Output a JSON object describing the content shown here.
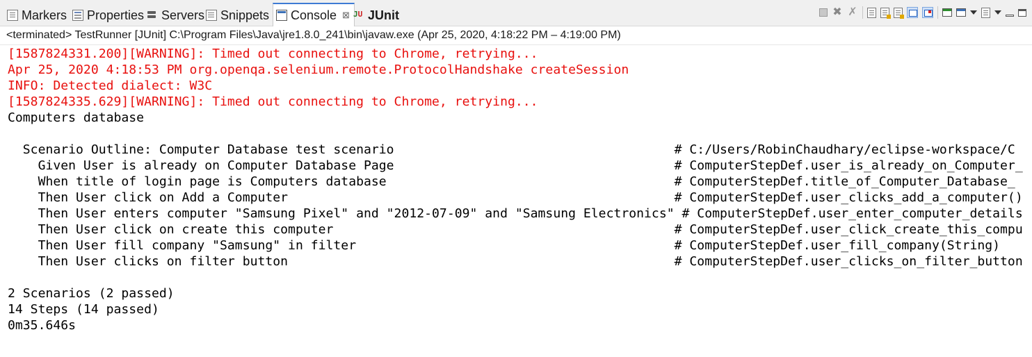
{
  "tabs": [
    {
      "label": "Markers",
      "icon": "markers-icon",
      "active": false
    },
    {
      "label": "Properties",
      "icon": "properties-icon",
      "active": false
    },
    {
      "label": "Servers",
      "icon": "servers-icon",
      "active": false
    },
    {
      "label": "Snippets",
      "icon": "snippets-icon",
      "active": false
    },
    {
      "label": "Console",
      "icon": "console-icon",
      "active": true,
      "close": "⊠"
    },
    {
      "label": "JUnit",
      "icon": "junit-icon",
      "active": false
    }
  ],
  "toolbar_icons": [
    "terminate-icon",
    "remove-launch-icon",
    "remove-all-terminated-icon",
    "scroll-lock-icon",
    "word-wrap-icon",
    "show-console-on-stdout-icon",
    "show-console-on-stderr-icon",
    "pin-console-icon",
    "display-selected-console-icon",
    "open-console-icon",
    "minimize-icon",
    "maximize-icon"
  ],
  "status_text": "<terminated> TestRunner [JUnit] C:\\Program Files\\Java\\jre1.8.0_241\\bin\\javaw.exe  (Apr 25, 2020, 4:18:22 PM – 4:19:00 PM)",
  "console_lines": [
    {
      "text": "[1587824331.200][WARNING]: Timed out connecting to Chrome, retrying...",
      "stream": "stderr"
    },
    {
      "text": "Apr 25, 2020 4:18:53 PM org.openqa.selenium.remote.ProtocolHandshake createSession",
      "stream": "stderr"
    },
    {
      "text": "INFO: Detected dialect: W3C",
      "stream": "stderr"
    },
    {
      "text": "[1587824335.629][WARNING]: Timed out connecting to Chrome, retrying...",
      "stream": "stderr"
    },
    {
      "text": "Computers database",
      "stream": "stdout"
    },
    {
      "text": "",
      "stream": "stdout"
    },
    {
      "text": "  Scenario Outline: Computer Database test scenario                                     # C:/Users/RobinChaudhary/eclipse-workspace/C",
      "stream": "stdout"
    },
    {
      "text": "    Given User is already on Computer Database Page                                     # ComputerStepDef.user_is_already_on_Computer_",
      "stream": "stdout"
    },
    {
      "text": "    When title of login page is Computers database                                      # ComputerStepDef.title_of_Computer_Database_",
      "stream": "stdout"
    },
    {
      "text": "    Then User click on Add a Computer                                                   # ComputerStepDef.user_clicks_add_a_computer()",
      "stream": "stdout"
    },
    {
      "text": "    Then User enters computer \"Samsung Pixel\" and \"2012-07-09\" and \"Samsung Electronics\" # ComputerStepDef.user_enter_computer_details",
      "stream": "stdout"
    },
    {
      "text": "    Then User click on create this computer                                             # ComputerStepDef.user_click_create_this_compu",
      "stream": "stdout"
    },
    {
      "text": "    Then User fill company \"Samsung\" in filter                                          # ComputerStepDef.user_fill_company(String)",
      "stream": "stdout"
    },
    {
      "text": "    Then User clicks on filter button                                                   # ComputerStepDef.user_clicks_on_filter_button",
      "stream": "stdout"
    },
    {
      "text": "",
      "stream": "stdout"
    },
    {
      "text": "2 Scenarios (2 passed)",
      "stream": "stdout"
    },
    {
      "text": "14 Steps (14 passed)",
      "stream": "stdout"
    },
    {
      "text": "0m35.646s",
      "stream": "stdout"
    }
  ],
  "colors": {
    "stderr": "#e8100e",
    "stdout": "#000000",
    "tab_accent": "#3d7bd4"
  }
}
